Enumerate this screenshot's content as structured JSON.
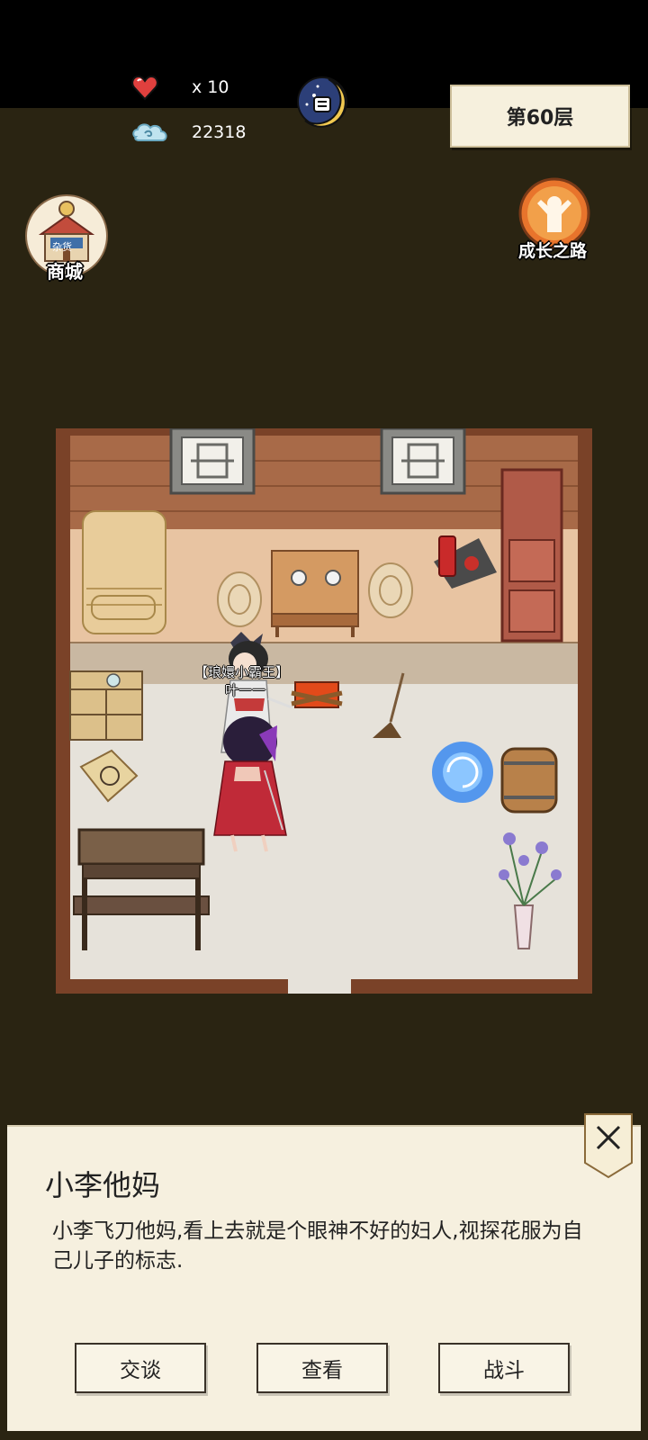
{
  "hud": {
    "lives": "x 10",
    "currency": "22318",
    "floor": "第60层",
    "icons": {
      "lives": "heart-icon",
      "currency": "cloud-icon",
      "day_night": "moon-icon"
    }
  },
  "side_buttons": {
    "shop_label": "商城",
    "shop_sign": "杂货",
    "growth_label": "成长之路"
  },
  "scene": {
    "player_title": "【琅嬛小霸王】",
    "player_name": "叶一一"
  },
  "dialog": {
    "npc_name": "小李他妈",
    "description": "小李飞刀他妈,看上去就是个眼神不好的妇人,视探花服为自己儿子的标志.",
    "actions": [
      "交谈",
      "查看",
      "战斗"
    ],
    "close_icon": "close-icon"
  },
  "colors": {
    "background": "#2a2412",
    "panel": "#f6f0df",
    "wall": "#8a5a3c",
    "floor": "#e6e2da"
  }
}
